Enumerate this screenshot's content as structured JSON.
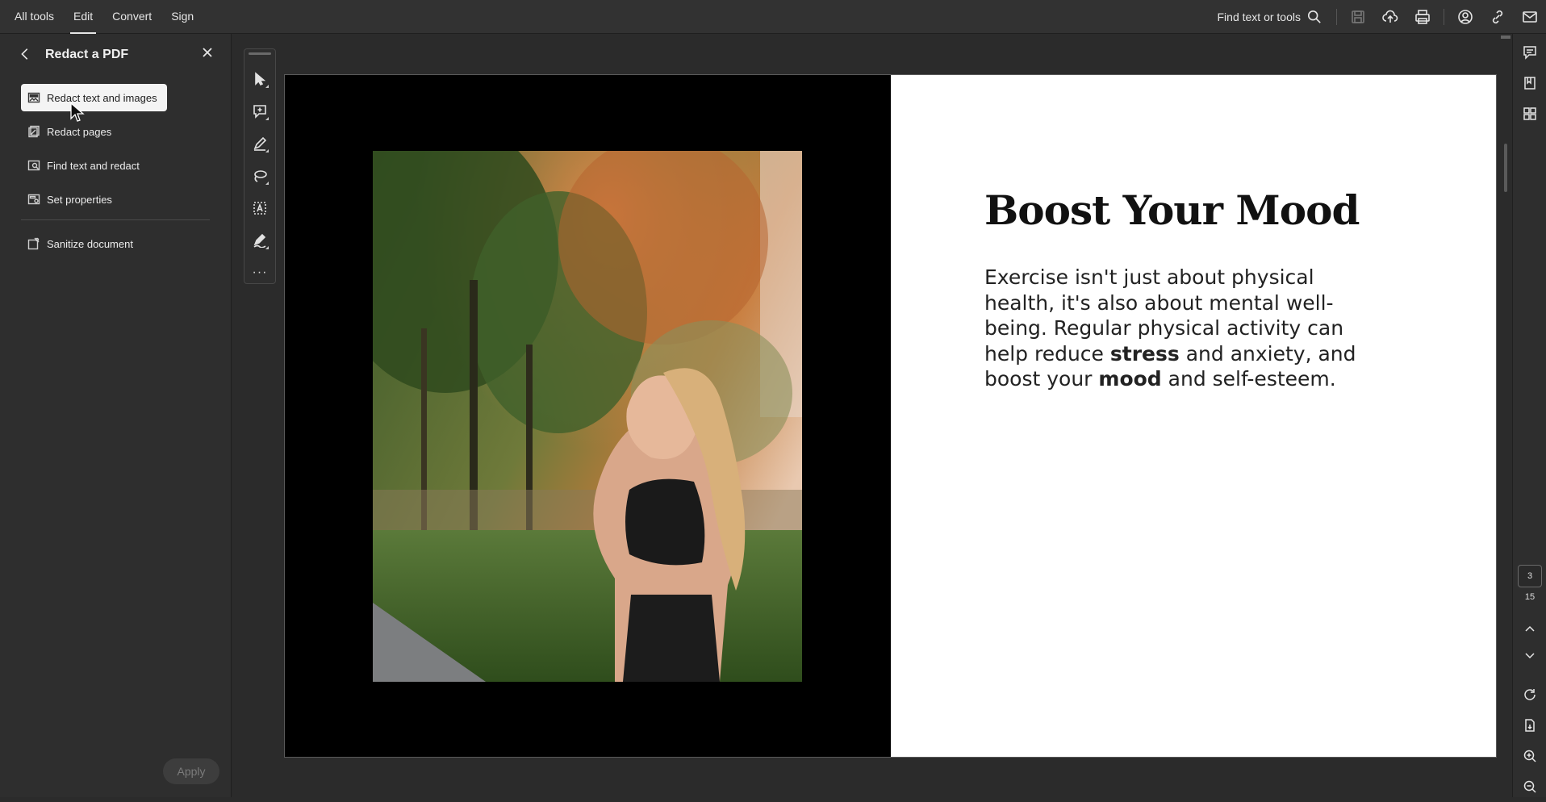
{
  "menu": {
    "items": [
      {
        "label": "All tools",
        "active": false
      },
      {
        "label": "Edit",
        "active": true
      },
      {
        "label": "Convert",
        "active": false
      },
      {
        "label": "Sign",
        "active": false
      }
    ]
  },
  "topbar": {
    "find_label": "Find text or tools",
    "icons": [
      "search-icon",
      "save-icon",
      "upload-cloud-icon",
      "print-icon",
      "share-user-icon",
      "link-icon",
      "mail-icon"
    ]
  },
  "panel": {
    "title": "Redact a PDF",
    "tools": [
      {
        "label": "Redact text and images",
        "icon": "redact-image-icon",
        "selected": true
      },
      {
        "label": "Redact pages",
        "icon": "redact-pages-icon",
        "selected": false
      },
      {
        "label": "Find text and redact",
        "icon": "find-redact-icon",
        "selected": false
      },
      {
        "label": "Set properties",
        "icon": "properties-icon",
        "selected": false
      }
    ],
    "sanitize_label": "Sanitize document",
    "apply_label": "Apply"
  },
  "quicktools": {
    "icons": [
      "select-cursor-icon",
      "add-comment-icon",
      "highlight-pen-icon",
      "lasso-icon",
      "text-select-icon",
      "fill-sign-icon",
      "more-icon"
    ],
    "more_label": "···"
  },
  "document": {
    "title": "Boost Your Mood",
    "body_parts": [
      {
        "text": "Exercise isn't just about physical health, it's also about mental well-being. Regular physical activity can help reduce ",
        "bold": false
      },
      {
        "text": "stress",
        "bold": true
      },
      {
        "text": " and anxiety, and boost your ",
        "bold": false
      },
      {
        "text": "mood",
        "bold": true
      },
      {
        "text": " and self-esteem.",
        "bold": false
      }
    ]
  },
  "rightrail": {
    "icons": [
      "comments-icon",
      "bookmark-icon",
      "thumbnails-icon",
      "chevron-up-icon",
      "chevron-down-icon",
      "rotate-icon",
      "page-export-icon",
      "zoom-in-icon",
      "zoom-out-icon"
    ],
    "current_page": "3",
    "total_pages": "15"
  }
}
